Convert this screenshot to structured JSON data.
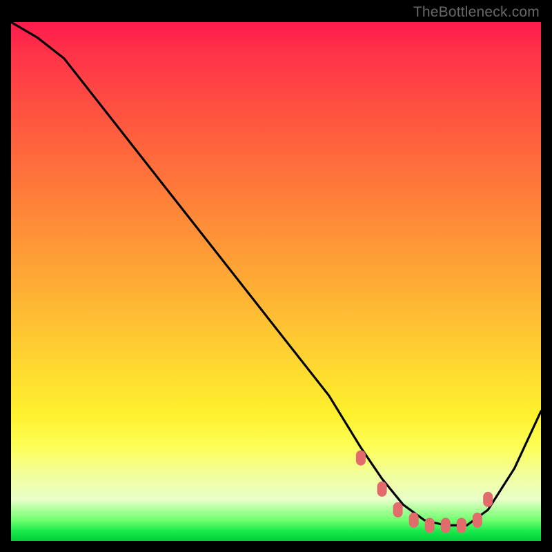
{
  "watermark": "TheBottleneck.com",
  "chart_data": {
    "type": "line",
    "title": "",
    "xlabel": "",
    "ylabel": "",
    "xlim": [
      0,
      100
    ],
    "ylim": [
      0,
      100
    ],
    "grid": false,
    "legend": false,
    "series": [
      {
        "name": "bottleneck-curve",
        "color": "#000000",
        "x": [
          0,
          5,
          10,
          20,
          30,
          40,
          50,
          60,
          66,
          70,
          74,
          78,
          82,
          86,
          90,
          95,
          100
        ],
        "values": [
          100,
          97,
          93,
          80,
          67,
          54,
          41,
          28,
          18,
          12,
          7,
          4,
          3,
          3,
          6,
          14,
          25
        ]
      }
    ],
    "markers": {
      "name": "optimal-band",
      "color": "#e26b6b",
      "x": [
        66,
        70,
        73,
        76,
        79,
        82,
        85,
        88,
        90
      ],
      "values": [
        16,
        10,
        6,
        4,
        3,
        3,
        3,
        4,
        8
      ]
    },
    "background": {
      "type": "vertical-gradient",
      "stops": [
        {
          "pos": 0,
          "color": "#ff1a4d"
        },
        {
          "pos": 0.5,
          "color": "#ffb335"
        },
        {
          "pos": 0.8,
          "color": "#fff430"
        },
        {
          "pos": 0.96,
          "color": "#6eff6e"
        },
        {
          "pos": 1.0,
          "color": "#00d038"
        }
      ]
    }
  }
}
